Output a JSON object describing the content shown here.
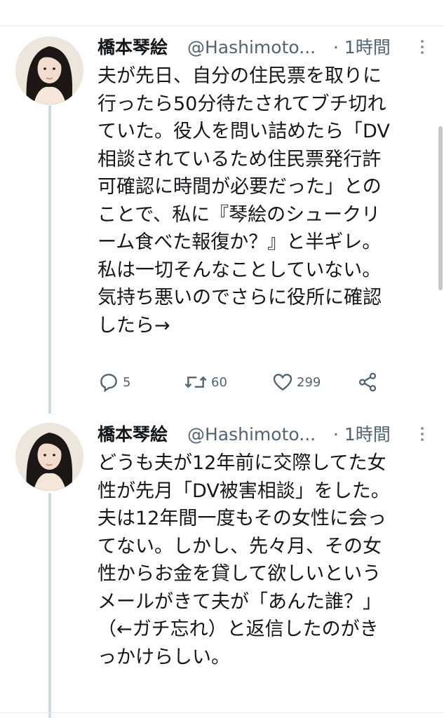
{
  "tweets": [
    {
      "name": "橋本琴絵",
      "handle": "@Hashimoto...",
      "time": "· 1時間",
      "text": "夫が先日、自分の住民票を取りに\n行ったら50分待たされてブチ切れ\nていた。役人を問い詰めたら「DV\n相談されているため住民票発行許\n可確認に時間が必要だった」との\nことで、私に『琴絵のシュークリ\nーム食べた報復か？』と半ギレ。\n私は一切そんなことしていない。\n気持ち悪いのでさらに役所に確認\nしたら→",
      "replies": "5",
      "retweets": "60",
      "likes": "299"
    },
    {
      "name": "橋本琴絵",
      "handle": "@Hashimoto...",
      "time": "· 1時間",
      "text": "どうも夫が12年前に交際してた女\n性が先月「DV被害相談」をした。\n夫は12年間一度もその女性に会っ\nてない。しかし、先々月、その女\n性からお金を貸して欲しいという\nメールがきて夫が「あんた誰？」\n（←ガチ忘れ）と返信したのがき\nっかけらしい。"
    }
  ],
  "icons": {
    "reply": "reply-bubble-icon",
    "retweet": "retweet-arrows-icon",
    "like": "heart-icon",
    "share": "share-nodes-icon",
    "more": "vertical-dots-icon"
  },
  "colors": {
    "text": "#14171a",
    "muted": "#536471",
    "thread_line": "#cfd9de"
  }
}
